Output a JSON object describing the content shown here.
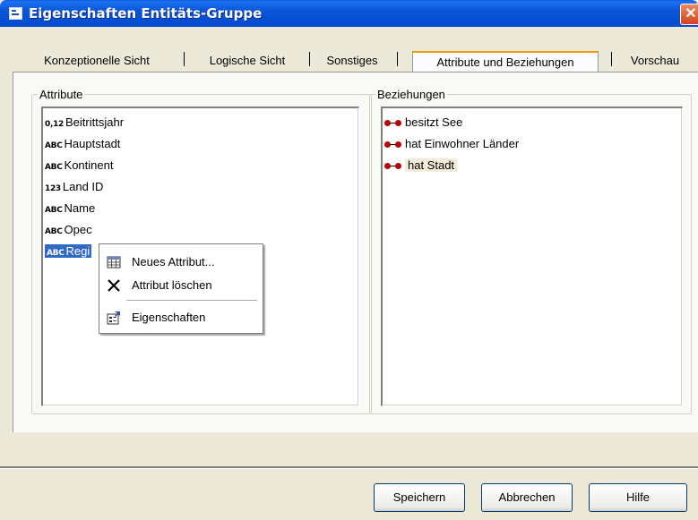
{
  "window": {
    "title": "Eigenschaften Entitäts-Gruppe",
    "close_glyph": "✕"
  },
  "tabs": [
    {
      "label": "Konzeptionelle Sicht",
      "active": false
    },
    {
      "label": "Logische Sicht",
      "active": false
    },
    {
      "label": "Sonstiges",
      "active": false
    },
    {
      "label": "Attribute und Beziehungen",
      "active": true
    },
    {
      "label": "Vorschau",
      "active": false
    }
  ],
  "attributes": {
    "label": "Attribute",
    "items": [
      {
        "type": "0,12",
        "name": "Beitrittsjahr"
      },
      {
        "type": "ABC",
        "name": "Hauptstadt"
      },
      {
        "type": "ABC",
        "name": "Kontinent"
      },
      {
        "type": "123",
        "name": "Land ID"
      },
      {
        "type": "ABC",
        "name": "Name"
      },
      {
        "type": "ABC",
        "name": "Opec"
      },
      {
        "type": "ABC",
        "name": "Regi",
        "selected": true
      }
    ]
  },
  "relations": {
    "label": "Beziehungen",
    "items": [
      {
        "name": "besitzt See"
      },
      {
        "name": "hat Einwohner Länder"
      },
      {
        "name": "hat Stadt",
        "highlighted": true
      }
    ]
  },
  "context_menu": {
    "items": [
      {
        "label": "Neues Attribut...",
        "icon": "table-icon"
      },
      {
        "label": "Attribut  löschen",
        "icon": "delete-x-icon"
      },
      {
        "label": "Eigenschaften",
        "icon": "properties-icon"
      }
    ]
  },
  "buttons": {
    "save": "Speichern",
    "cancel": "Abbrechen",
    "help": "Hilfe"
  },
  "colors": {
    "titlebar": "#0a55d8",
    "selection": "#316ac5",
    "relation_dot": "#c00000",
    "active_tab_accent": "#e5a00a"
  }
}
